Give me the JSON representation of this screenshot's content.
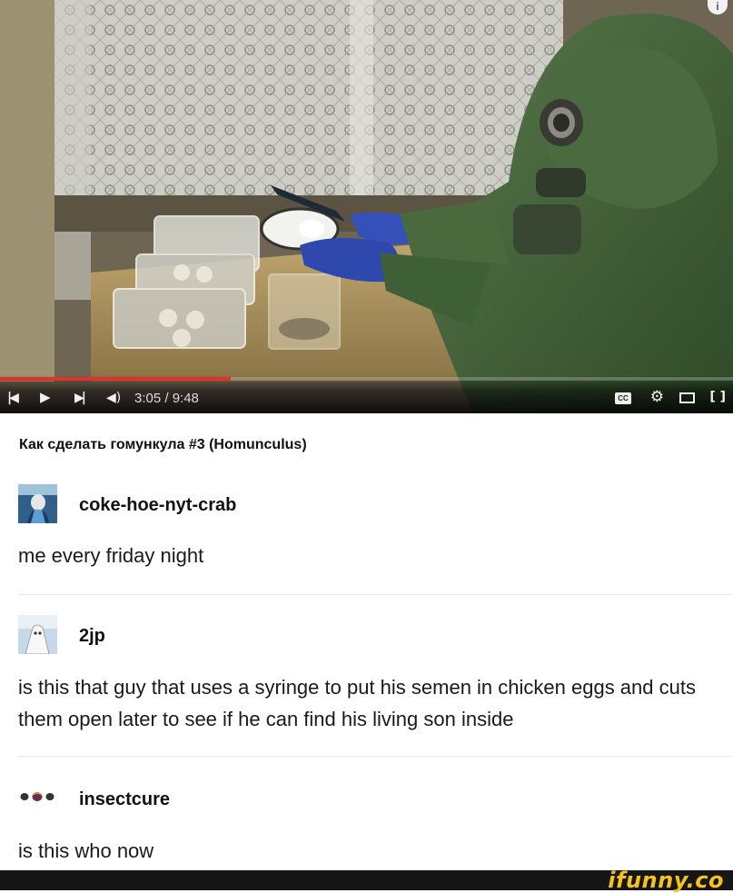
{
  "player": {
    "current_time": "3:05",
    "duration": "9:48",
    "time_display": "3:05 / 9:48",
    "progress": 0.315,
    "accent_color": "#e0312a",
    "controls": {
      "prev_icon": "skip-previous-icon",
      "play_icon": "play-icon",
      "next_icon": "skip-next-icon",
      "volume_icon": "volume-icon",
      "cc_label": "CC",
      "settings_icon": "gear-icon",
      "miniplayer_icon": "miniplayer-icon",
      "fullscreen_icon": "fullscreen-icon"
    },
    "info_label": "i"
  },
  "video_title": "Как сделать гомункула #3 (Homunculus)",
  "notes": [
    {
      "username": "coke-hoe-nyt-crab",
      "text": "me every friday night"
    },
    {
      "username": "2jp",
      "text": "is this that guy that uses a syringe to put his semen in chicken eggs and cuts them open later to see if he can find his living son inside"
    },
    {
      "username": "insectcure",
      "text": "is this who now"
    }
  ],
  "watermark": "ifunny.co",
  "watermark_color": "#f6c21b"
}
